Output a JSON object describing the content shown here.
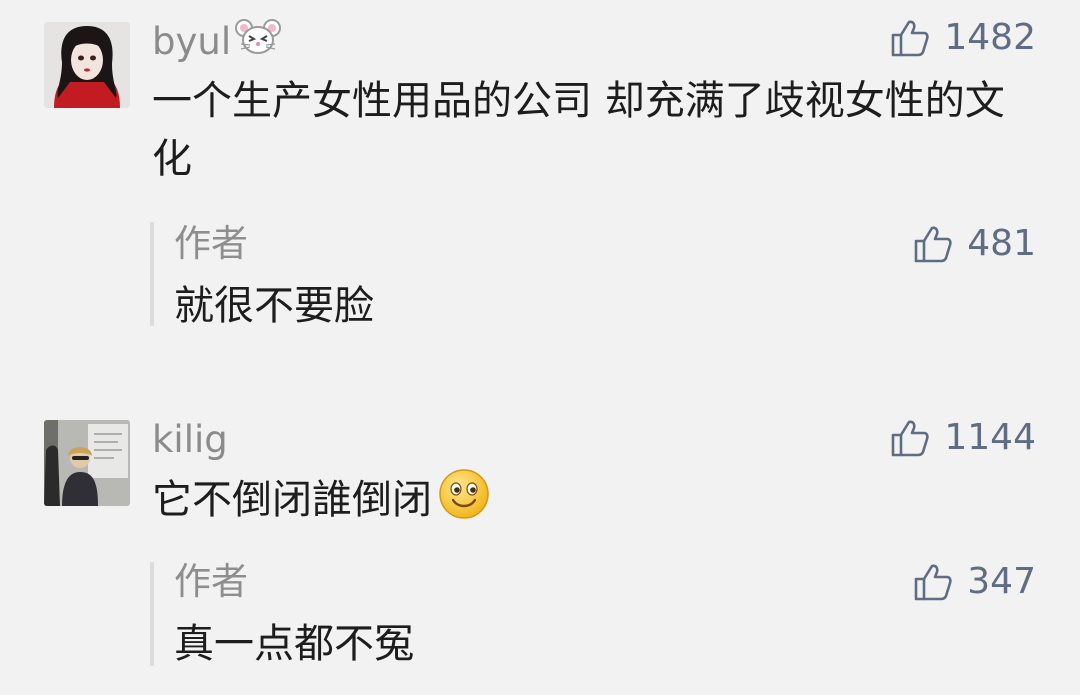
{
  "comments": [
    {
      "username": "byul",
      "username_emoji": "mouse-face-icon",
      "likes": "1482",
      "text": "一个生产女性用品的公司 却充满了歧视女性的文化",
      "reply": {
        "author": "作者",
        "likes": "481",
        "text": "就很不要脸"
      }
    },
    {
      "username": "kilig",
      "likes": "1144",
      "text": "它不倒闭誰倒闭",
      "text_emoji": "smiley-face-icon",
      "reply": {
        "author": "作者",
        "likes": "347",
        "text": "真一点都不冤"
      }
    }
  ],
  "colors": {
    "background": "#f2f2f2",
    "username": "#8b8b8b",
    "like_count": "#5e6d84",
    "comment_text": "#1d1d1d"
  }
}
